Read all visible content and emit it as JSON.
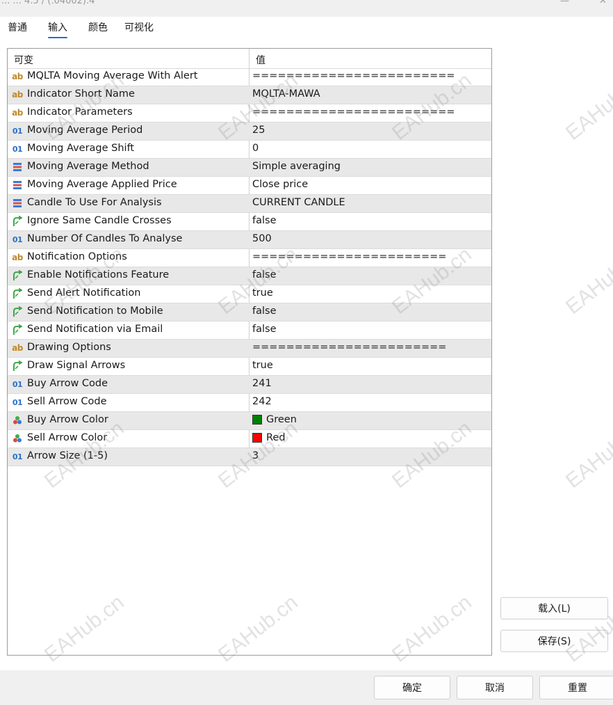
{
  "window": {
    "title": "... ... 4.5 / (.04002).4",
    "close_glyph": "✕",
    "min_glyph": "—"
  },
  "tabs": [
    {
      "label": "普通"
    },
    {
      "label": "输入"
    },
    {
      "label": "颜色"
    },
    {
      "label": "可视化"
    }
  ],
  "grid": {
    "header": {
      "name": "可变",
      "value": "值"
    },
    "rows": [
      {
        "icon": "ab",
        "name": "MQLTA Moving Average With Alert",
        "value": "========================"
      },
      {
        "icon": "ab",
        "name": "Indicator Short Name",
        "value": "MQLTA-MAWA"
      },
      {
        "icon": "ab",
        "name": "Indicator Parameters",
        "value": "========================"
      },
      {
        "icon": "01",
        "name": "Moving Average Period",
        "value": "25"
      },
      {
        "icon": "01",
        "name": "Moving Average Shift",
        "value": "0"
      },
      {
        "icon": "enum",
        "name": "Moving Average Method",
        "value": "Simple averaging"
      },
      {
        "icon": "enum",
        "name": "Moving Average Applied Price",
        "value": "Close price"
      },
      {
        "icon": "enum",
        "name": "Candle To Use For Analysis",
        "value": "CURRENT CANDLE"
      },
      {
        "icon": "bool",
        "name": "Ignore Same Candle Crosses",
        "value": "false"
      },
      {
        "icon": "01",
        "name": "Number Of Candles To Analyse",
        "value": "500"
      },
      {
        "icon": "ab",
        "name": "Notification Options",
        "value": "======================="
      },
      {
        "icon": "bool",
        "name": "Enable Notifications Feature",
        "value": "false"
      },
      {
        "icon": "bool",
        "name": "Send Alert Notification",
        "value": "true"
      },
      {
        "icon": "bool",
        "name": "Send Notification to Mobile",
        "value": "false"
      },
      {
        "icon": "bool",
        "name": "Send Notification via Email",
        "value": "false"
      },
      {
        "icon": "ab",
        "name": "Drawing Options",
        "value": "======================="
      },
      {
        "icon": "bool",
        "name": "Draw Signal Arrows",
        "value": "true"
      },
      {
        "icon": "01",
        "name": "Buy Arrow Code",
        "value": "241"
      },
      {
        "icon": "01",
        "name": "Sell Arrow Code",
        "value": "242"
      },
      {
        "icon": "color",
        "name": "Buy Arrow Color",
        "value": "Green",
        "swatch": "#008000"
      },
      {
        "icon": "color",
        "name": "Sell Arrow Color",
        "value": "Red",
        "swatch": "#ff0000"
      },
      {
        "icon": "01",
        "name": "Arrow Size (1-5)",
        "value": "3"
      }
    ]
  },
  "side_buttons": {
    "load": "载入(L)",
    "save": "保存(S)"
  },
  "footer_buttons": {
    "ok": "确定",
    "cancel": "取消",
    "reset": "重置"
  },
  "watermark": "EAHub.cn",
  "colors": {
    "accent": "#1f6fcf",
    "alt_row": "#e8e8e8",
    "bool_icon": "#2e9e3c",
    "int_icon": "#2b6fc7",
    "string_icon": "#c0882a",
    "enum_icon_blue": "#3a7bd5",
    "enum_icon_red": "#d9534f"
  }
}
